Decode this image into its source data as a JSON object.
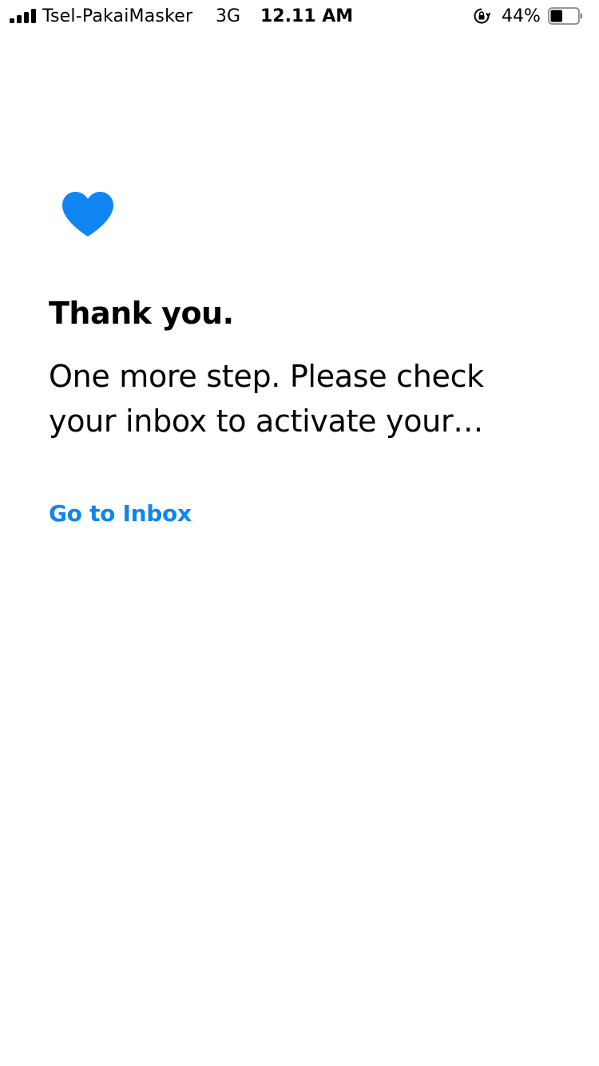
{
  "status_bar": {
    "carrier": "Tsel-PakaiMasker",
    "network": "3G",
    "time": "12.11 AM",
    "battery_percent": "44%",
    "battery_level": 0.44
  },
  "main": {
    "icon": "heart-icon",
    "accent_color": "#0f85f2",
    "title": "Thank you.",
    "message": "One more step. Please check your inbox to activate your account.",
    "link_label": "Go to Inbox"
  }
}
